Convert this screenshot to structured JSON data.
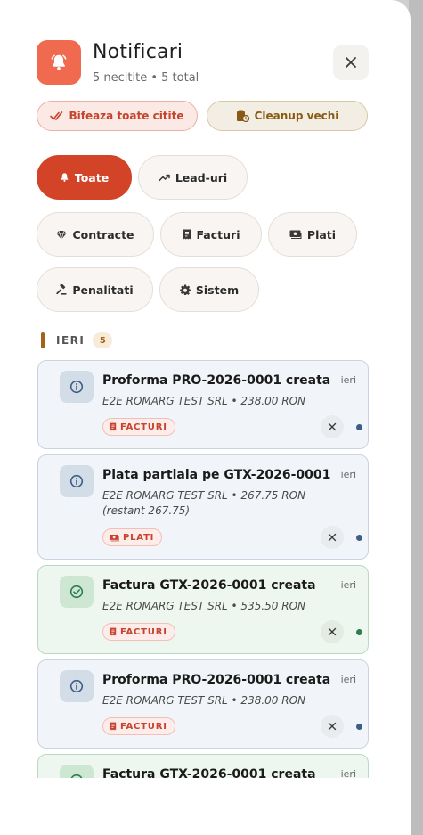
{
  "header": {
    "title": "Notificari",
    "subtitle": "5 necitite • 5 total",
    "icon": "bell-icon",
    "accent": "#ef6a4e"
  },
  "actions": {
    "mark_all_read": "Bifeaza toate citite",
    "cleanup_old": "Cleanup vechi"
  },
  "filters": [
    {
      "label": "Toate",
      "icon": "bell-icon",
      "active": true
    },
    {
      "label": "Lead-uri",
      "icon": "trend-up-icon",
      "active": false
    },
    {
      "label": "Contracte",
      "icon": "gem-icon",
      "active": false
    },
    {
      "label": "Facturi",
      "icon": "receipt-icon",
      "active": false
    },
    {
      "label": "Plati",
      "icon": "cash-icon",
      "active": false
    },
    {
      "label": "Penalitati",
      "icon": "gavel-icon",
      "active": false
    },
    {
      "label": "Sistem",
      "icon": "gear-icon",
      "active": false
    }
  ],
  "group": {
    "label": "IERI",
    "count": "5"
  },
  "notifications": [
    {
      "title": "Proforma PRO-2026-0001 creata",
      "time": "ieri",
      "description": "E2E ROMARG TEST SRL • 238.00 RON",
      "badge": "FACTURI",
      "badge_icon": "receipt-icon",
      "status": "info",
      "icon": "info-icon",
      "dot_color": "#3f5d86"
    },
    {
      "title": "Plata partiala pe GTX-2026-0001",
      "time": "ieri",
      "description": "E2E ROMARG TEST SRL • 267.75 RON (restant 267.75)",
      "badge": "PLATI",
      "badge_icon": "cash-icon",
      "status": "info",
      "icon": "info-icon",
      "dot_color": "#3f5d86"
    },
    {
      "title": "Factura GTX-2026-0001 creata",
      "time": "ieri",
      "description": "E2E ROMARG TEST SRL • 535.50 RON",
      "badge": "FACTURI",
      "badge_icon": "receipt-icon",
      "status": "success",
      "icon": "check-circle-icon",
      "dot_color": "#2e7d4f"
    },
    {
      "title": "Proforma PRO-2026-0001 creata",
      "time": "ieri",
      "description": "E2E ROMARG TEST SRL • 238.00 RON",
      "badge": "FACTURI",
      "badge_icon": "receipt-icon",
      "status": "info",
      "icon": "info-icon",
      "dot_color": "#3f5d86"
    },
    {
      "title": "Factura GTX-2026-0001 creata",
      "time": "ieri",
      "description": "",
      "badge": "",
      "badge_icon": "",
      "status": "success",
      "icon": "check-circle-icon",
      "dot_color": "#2e7d4f"
    }
  ]
}
